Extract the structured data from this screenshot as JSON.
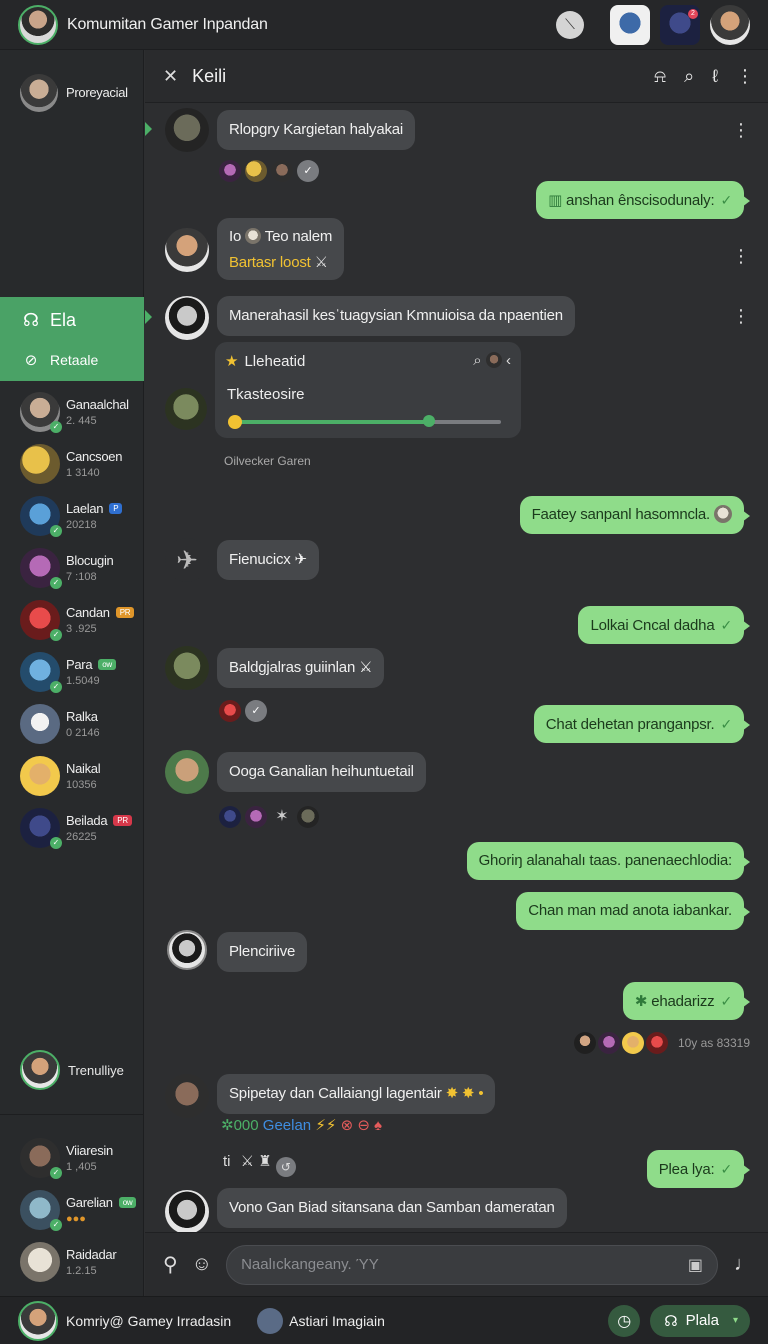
{
  "app": {
    "title": "Komumitan Gamer Inpandan"
  },
  "topbar": {
    "notif_badge": "2"
  },
  "sidebar": {
    "user_name": "Proreyacial",
    "green_items": [
      {
        "label": "Ela",
        "icon": "chat-icon"
      },
      {
        "label": "Retaale",
        "icon": "search-icon"
      }
    ],
    "contacts": [
      {
        "name": "Ganaalchal",
        "sub": "2. 445"
      },
      {
        "name": "Cancsoen",
        "sub": "1 3140"
      },
      {
        "name": "Laelan",
        "sub": "20218",
        "badge": "P",
        "badge_color": "#2f6fd0"
      },
      {
        "name": "Blocugin",
        "sub": "7 :108"
      },
      {
        "name": "Candan",
        "sub": "3 .925",
        "badge": "PR",
        "badge_color": "#e0962a"
      },
      {
        "name": "Para",
        "sub": "1.5049",
        "badge": "ow",
        "badge_color": "#4caf67"
      },
      {
        "name": "Ralka",
        "sub": "0 2146"
      },
      {
        "name": "Naikal",
        "sub": "10356"
      },
      {
        "name": "Beilada",
        "sub": "26225",
        "badge": "PR",
        "badge_color": "#d6384a"
      }
    ],
    "bottom_user": "Trenulliye",
    "contacts2": [
      {
        "name": "Viiaresin",
        "sub": "1 ,405"
      },
      {
        "name": "Garelian",
        "sub": "",
        "badge": "ow",
        "badge_color": "#4caf67"
      },
      {
        "name": "Raidadar",
        "sub": "1.2.15"
      }
    ]
  },
  "chat": {
    "title": "Keili",
    "messages": {
      "m1": "Rlopgry Kargietan halyakai",
      "m2": "anshan ênscisodunaly:",
      "m3_line1": "Teo nalem",
      "m3_prefix": "Io",
      "m3_line2": "Bartasr loost",
      "m4": "Manerahasil kesˈtuagysian Kmnuioisa da npaentien",
      "poll_title": "Lleheatid",
      "poll_label": "Tkasteosire",
      "poll_caption": "Oilvecker Garen",
      "poll_progress": 0.73,
      "m5": "Faatey sanpanl hasomncla.",
      "m6": "Fienucicx",
      "m7": "Lolkai Cncal dadha",
      "m8": "Baldgjalras guiinlan",
      "m9": "Chat dehetan pranganpsr.",
      "m10": "Ooga Ganalian heihuntuetail",
      "m11": "Ghoriŋ alanahalı taas. panenaechlodia:",
      "m12": "Chan man mad anota iabankar.",
      "m13": "Plenciriive",
      "m14": "ehadarizz",
      "meta": "10y as 83319",
      "m15": "Spipetay dan Callaiangl lagentair",
      "m15_sub_a": "✲000",
      "m15_sub_b": "Geelan",
      "m16_prefix": "ti",
      "m17": "Plea lya:",
      "m18": "Vono Gan Biad sitansana dan Samban dameratan"
    }
  },
  "composer": {
    "placeholder": "Naalıckangeany. ΎY"
  },
  "bottombar": {
    "user1": "Komriy@ Gamey Irradasin",
    "user2": "Astiari Imagiain",
    "play_label": "Plala"
  },
  "colors": {
    "accent": "#4aa266",
    "out_bubble": "#8fdc8a",
    "in_bubble": "#46484b"
  }
}
